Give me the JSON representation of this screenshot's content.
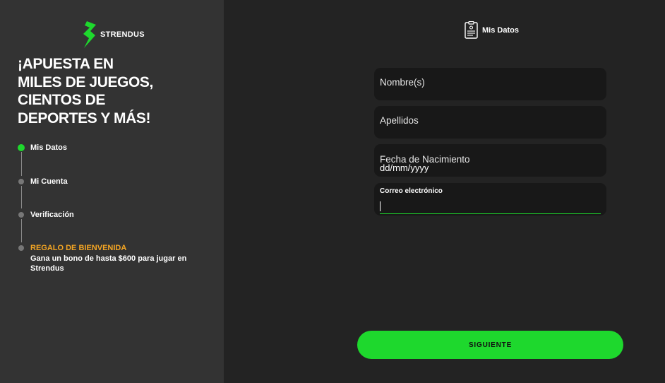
{
  "brand": {
    "name": "STRENDUS",
    "accent_color": "#1ed82d",
    "highlight_color": "#f5a623"
  },
  "sidebar": {
    "headline_lines": [
      "¡APUESTA EN",
      "MILES DE JUEGOS,",
      "CIENTOS DE",
      "DEPORTES Y MÁS!"
    ],
    "steps": [
      {
        "label": "Mis Datos",
        "state": "active"
      },
      {
        "label": "Mi Cuenta",
        "state": "pending"
      },
      {
        "label": "Verificación",
        "state": "pending"
      }
    ],
    "bonus": {
      "title": "REGALO DE BIENVENIDA",
      "text": "Gana un bono de hasta $600 para jugar en Strendus"
    }
  },
  "header": {
    "current_step_label": "Mis Datos",
    "current_step_icon": "form-document-icon"
  },
  "form": {
    "first_name": {
      "label": "Nombre(s)",
      "value": ""
    },
    "last_name": {
      "label": "Apellidos",
      "value": ""
    },
    "birth_date": {
      "label": "Fecha de Nacimiento",
      "placeholder": "dd/mm/yyyy",
      "value": ""
    },
    "email": {
      "label": "Correo electrónico",
      "value": "",
      "focused": true
    }
  },
  "actions": {
    "next_label": "SIGUIENTE"
  }
}
